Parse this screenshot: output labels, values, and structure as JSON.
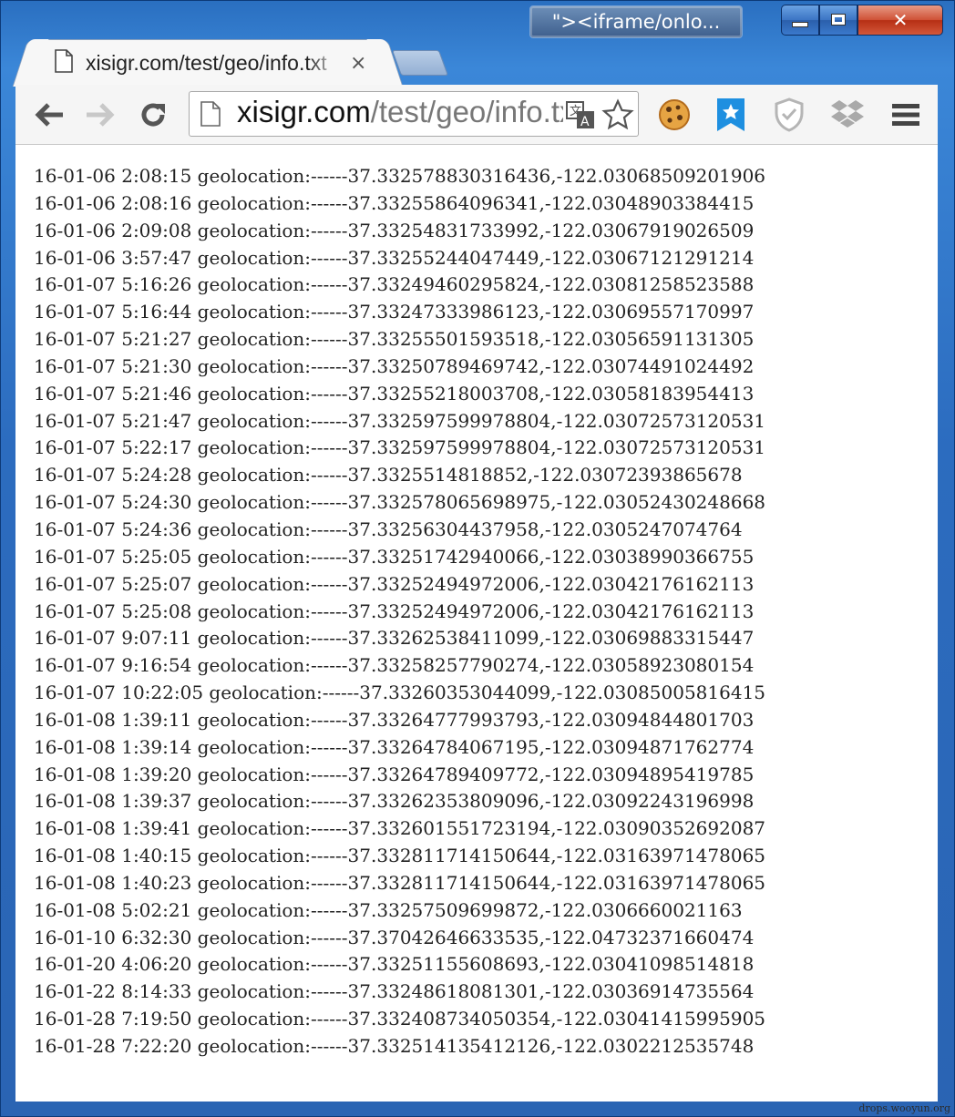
{
  "window": {
    "user_badge": "\"><iframe/onlo...",
    "min_label": "",
    "close_label": "✕"
  },
  "tab": {
    "title": "xisigr.com/test/geo/info.txt",
    "close": "×"
  },
  "address_bar": {
    "host": "xisigr.com",
    "path": "/test/geo/info.txt"
  },
  "icons": [
    "back-icon",
    "forward-icon",
    "reload-icon",
    "page-icon",
    "translate-icon",
    "star-icon",
    "cookie-extension-icon",
    "bookmark-extension-icon",
    "shield-extension-icon",
    "dropbox-extension-icon",
    "menu-icon"
  ],
  "colors": {
    "frame": "#2a6fc0",
    "close": "#cf5136",
    "bookmark_ext": "#1e8fe0"
  },
  "log_lines": [
    "16-01-06 2:08:15 geolocation:------37.332578830316436,-122.03068509201906",
    "16-01-06 2:08:16 geolocation:------37.33255864096341,-122.03048903384415",
    "16-01-06 2:09:08 geolocation:------37.33254831733992,-122.03067919026509",
    "16-01-06 3:57:47 geolocation:------37.33255244047449,-122.03067121291214",
    "16-01-07 5:16:26 geolocation:------37.33249460295824,-122.03081258523588",
    "16-01-07 5:16:44 geolocation:------37.33247333986123,-122.03069557170997",
    "16-01-07 5:21:27 geolocation:------37.33255501593518,-122.03056591131305",
    "16-01-07 5:21:30 geolocation:------37.33250789469742,-122.03074491024492",
    "16-01-07 5:21:46 geolocation:------37.33255218003708,-122.03058183954413",
    "16-01-07 5:21:47 geolocation:------37.332597599978804,-122.03072573120531",
    "16-01-07 5:22:17 geolocation:------37.332597599978804,-122.03072573120531",
    "16-01-07 5:24:28 geolocation:------37.3325514818852,-122.03072393865678",
    "16-01-07 5:24:30 geolocation:------37.332578065698975,-122.03052430248668",
    "16-01-07 5:24:36 geolocation:------37.33256304437958,-122.0305247074764",
    "16-01-07 5:25:05 geolocation:------37.33251742940066,-122.03038990366755",
    "16-01-07 5:25:07 geolocation:------37.33252494972006,-122.03042176162113",
    "16-01-07 5:25:08 geolocation:------37.33252494972006,-122.03042176162113",
    "16-01-07 9:07:11 geolocation:------37.33262538411099,-122.03069883315447",
    "16-01-07 9:16:54 geolocation:------37.33258257790274,-122.03058923080154",
    "16-01-07 10:22:05 geolocation:------37.33260353044099,-122.03085005816415",
    "16-01-08 1:39:11 geolocation:------37.33264777993793,-122.03094844801703",
    "16-01-08 1:39:14 geolocation:------37.33264784067195,-122.03094871762774",
    "16-01-08 1:39:20 geolocation:------37.33264789409772,-122.03094895419785",
    "16-01-08 1:39:37 geolocation:------37.33262353809096,-122.03092243196998",
    "16-01-08 1:39:41 geolocation:------37.332601551723194,-122.03090352692087",
    "16-01-08 1:40:15 geolocation:------37.332811714150644,-122.03163971478065",
    "16-01-08 1:40:23 geolocation:------37.332811714150644,-122.03163971478065",
    "16-01-08 5:02:21 geolocation:------37.33257509699872,-122.0306660021163",
    "16-01-10 6:32:30 geolocation:------37.37042646633535,-122.04732371660474",
    "16-01-20 4:06:20 geolocation:------37.33251155608693,-122.03041098514818",
    "16-01-22 8:14:33 geolocation:------37.33248618081301,-122.03036914735564",
    "16-01-28 7:19:50 geolocation:------37.332408734050354,-122.03041415995905",
    "16-01-28 7:22:20 geolocation:------37.332514135412126,-122.0302212535748"
  ],
  "watermark": "drops.wooyun.org"
}
